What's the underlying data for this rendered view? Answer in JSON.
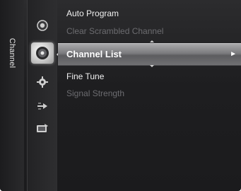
{
  "category": {
    "label": "Channel"
  },
  "icons": [
    {
      "name": "picture-icon"
    },
    {
      "name": "channel-icon",
      "active": true
    },
    {
      "name": "setup-icon"
    },
    {
      "name": "input-icon"
    },
    {
      "name": "application-icon"
    }
  ],
  "menu": {
    "items": [
      {
        "label": "Auto Program",
        "state": "normal"
      },
      {
        "label": "Clear Scrambled Channel",
        "state": "disabled"
      },
      {
        "label": "Channel List",
        "state": "selected"
      },
      {
        "label": "Fine Tune",
        "state": "normal"
      },
      {
        "label": "Signal Strength",
        "state": "disabled"
      }
    ],
    "selected_arrow": "►"
  },
  "colors": {
    "background": "#1e1e20",
    "selected_highlight": "#8a8a8d",
    "disabled_text": "#6c6c70",
    "normal_text": "#f0f0f0"
  }
}
